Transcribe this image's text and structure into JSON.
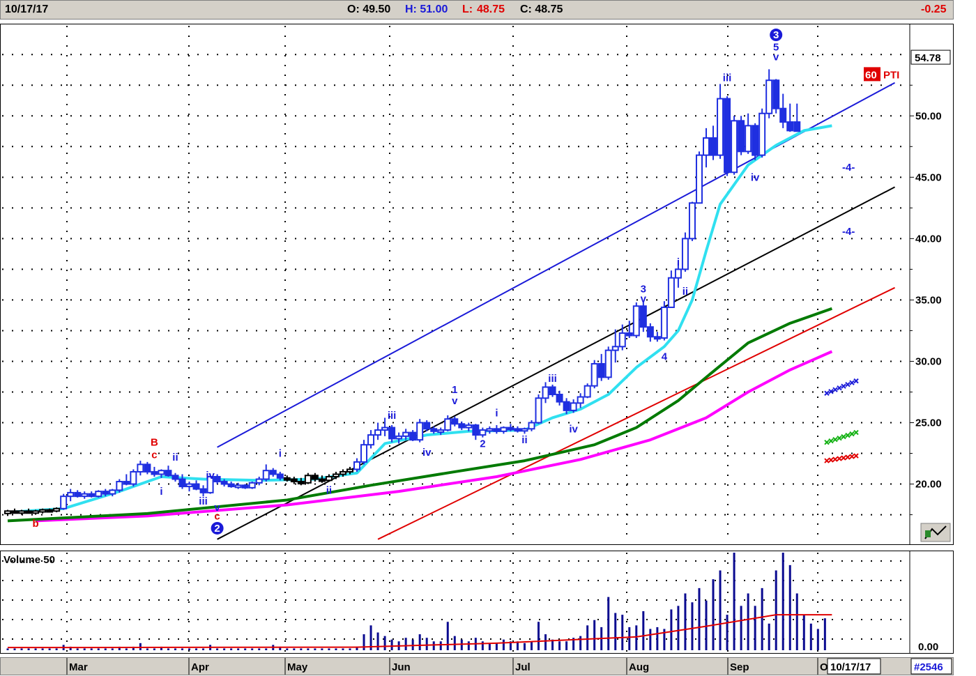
{
  "header": {
    "date": "10/17/17",
    "open": "O: 49.50",
    "high": "H: 51.00",
    "low_label": "L:",
    "low_value": "48.75",
    "close": "C: 48.75",
    "change": "-0.25"
  },
  "colors": {
    "candles": "#1f2fe0",
    "candles_early": "#000000",
    "ema_short": "#30e0f0",
    "ma_mid": "#007a00",
    "ma_long": "#ff00ff",
    "channel_upper": "#1a1ad8",
    "channel_mid": "#000000",
    "channel_lower": "#e00000",
    "volume_bars": "#0a0a90",
    "volume_avg": "#e00000"
  },
  "icons": [
    "chart-settings-icon"
  ],
  "chart_data": {
    "type": "candlestick",
    "ylim": [
      16,
      57
    ],
    "y_ticks": [
      "20.00",
      "25.00",
      "30.00",
      "35.00",
      "40.00",
      "45.00",
      "50.00"
    ],
    "last_price_label": "54.78",
    "indicator_label": {
      "number": "60",
      "text": "PTI"
    },
    "months": [
      "Mar",
      "Apr",
      "May",
      "Jun",
      "Jul",
      "Aug",
      "Sep",
      "O"
    ],
    "current_date_label": "10/17/17",
    "volume_title": "Volume 50",
    "volume_tick": "0.00",
    "footer_code": "#2546",
    "candles": [
      [
        17.6,
        17.9,
        17.4,
        17.8
      ],
      [
        17.8,
        18.0,
        17.6,
        17.7
      ],
      [
        17.7,
        17.9,
        17.5,
        17.8
      ],
      [
        17.8,
        18.0,
        17.6,
        17.7
      ],
      [
        17.7,
        17.9,
        17.5,
        17.8
      ],
      [
        17.8,
        18.0,
        17.6,
        17.9
      ],
      [
        17.9,
        18.0,
        17.7,
        17.8
      ],
      [
        17.8,
        18.1,
        17.7,
        18.0
      ],
      [
        18.0,
        19.2,
        17.9,
        19.0
      ],
      [
        19.0,
        19.6,
        18.6,
        19.3
      ],
      [
        19.3,
        19.5,
        18.9,
        19.0
      ],
      [
        19.0,
        19.4,
        18.8,
        19.2
      ],
      [
        19.2,
        19.4,
        18.9,
        19.0
      ],
      [
        19.0,
        19.5,
        18.9,
        19.4
      ],
      [
        19.4,
        19.6,
        19.0,
        19.2
      ],
      [
        19.2,
        19.6,
        19.0,
        19.5
      ],
      [
        19.5,
        20.4,
        19.3,
        20.2
      ],
      [
        20.2,
        20.8,
        19.9,
        20.0
      ],
      [
        20.0,
        21.2,
        19.8,
        21.0
      ],
      [
        21.0,
        21.9,
        20.7,
        21.6
      ],
      [
        21.6,
        21.8,
        20.8,
        21.0
      ],
      [
        21.0,
        21.4,
        20.6,
        20.8
      ],
      [
        20.8,
        21.2,
        20.5,
        21.1
      ],
      [
        21.1,
        21.5,
        20.6,
        20.7
      ],
      [
        20.7,
        20.9,
        20.2,
        20.4
      ],
      [
        20.4,
        20.8,
        19.6,
        19.8
      ],
      [
        19.8,
        20.2,
        19.4,
        20.0
      ],
      [
        20.0,
        20.3,
        19.5,
        19.6
      ],
      [
        19.6,
        19.9,
        19.0,
        19.3
      ],
      [
        19.3,
        20.8,
        19.2,
        20.6
      ],
      [
        20.6,
        20.8,
        20.0,
        20.2
      ],
      [
        20.2,
        20.4,
        19.8,
        20.0
      ],
      [
        20.0,
        20.2,
        19.7,
        19.8
      ],
      [
        19.8,
        20.1,
        19.6,
        19.9
      ],
      [
        19.9,
        20.0,
        19.6,
        19.7
      ],
      [
        19.7,
        20.2,
        19.6,
        20.1
      ],
      [
        20.1,
        20.6,
        19.9,
        20.4
      ],
      [
        20.4,
        21.6,
        20.2,
        21.1
      ],
      [
        21.1,
        21.3,
        20.6,
        20.8
      ],
      [
        20.8,
        21.0,
        20.3,
        20.5
      ],
      [
        20.5,
        20.7,
        20.2,
        20.4
      ],
      [
        20.4,
        20.6,
        20.0,
        20.2
      ],
      [
        20.2,
        20.5,
        19.9,
        20.1
      ],
      [
        20.1,
        20.9,
        20.0,
        20.7
      ],
      [
        20.7,
        20.9,
        20.2,
        20.4
      ],
      [
        20.4,
        20.7,
        20.1,
        20.3
      ],
      [
        20.3,
        20.8,
        20.2,
        20.6
      ],
      [
        20.6,
        21.0,
        20.4,
        20.8
      ],
      [
        20.8,
        21.2,
        20.6,
        21.0
      ],
      [
        21.0,
        21.4,
        20.8,
        21.2
      ],
      [
        21.2,
        22.1,
        21.0,
        21.8
      ],
      [
        21.8,
        23.6,
        21.6,
        23.2
      ],
      [
        23.2,
        24.4,
        22.9,
        24.0
      ],
      [
        24.0,
        25.0,
        23.6,
        24.4
      ],
      [
        24.4,
        25.4,
        23.9,
        24.6
      ],
      [
        24.6,
        24.8,
        23.4,
        23.7
      ],
      [
        23.7,
        24.2,
        23.3,
        23.9
      ],
      [
        23.9,
        24.5,
        23.6,
        24.2
      ],
      [
        24.2,
        24.4,
        23.5,
        23.6
      ],
      [
        23.6,
        25.3,
        23.4,
        25.0
      ],
      [
        25.0,
        25.2,
        24.3,
        24.5
      ],
      [
        24.5,
        24.7,
        24.1,
        24.3
      ],
      [
        24.3,
        24.6,
        24.0,
        24.4
      ],
      [
        24.4,
        25.6,
        24.3,
        25.3
      ],
      [
        25.3,
        25.5,
        24.7,
        24.9
      ],
      [
        24.9,
        25.1,
        24.4,
        24.6
      ],
      [
        24.6,
        25.0,
        24.3,
        24.8
      ],
      [
        24.8,
        24.9,
        23.6,
        24.0
      ],
      [
        24.0,
        24.6,
        23.8,
        24.4
      ],
      [
        24.4,
        24.7,
        24.1,
        24.5
      ],
      [
        24.5,
        24.8,
        24.1,
        24.3
      ],
      [
        24.3,
        24.7,
        24.1,
        24.6
      ],
      [
        24.6,
        24.9,
        24.3,
        24.5
      ],
      [
        24.5,
        24.7,
        24.2,
        24.4
      ],
      [
        24.4,
        24.6,
        24.1,
        24.5
      ],
      [
        24.5,
        25.2,
        24.3,
        25.0
      ],
      [
        25.0,
        27.3,
        24.9,
        27.0
      ],
      [
        27.0,
        28.3,
        26.6,
        27.9
      ],
      [
        27.9,
        28.1,
        27.1,
        27.3
      ],
      [
        27.3,
        27.6,
        26.4,
        26.7
      ],
      [
        26.7,
        27.0,
        25.7,
        26.0
      ],
      [
        26.0,
        26.9,
        25.8,
        26.6
      ],
      [
        26.6,
        27.4,
        26.2,
        27.1
      ],
      [
        27.1,
        28.2,
        27.0,
        28.0
      ],
      [
        28.0,
        30.1,
        27.8,
        29.8
      ],
      [
        29.8,
        30.6,
        28.4,
        28.7
      ],
      [
        28.7,
        31.2,
        28.5,
        30.9
      ],
      [
        30.9,
        32.6,
        29.9,
        31.2
      ],
      [
        31.2,
        33.0,
        30.9,
        32.3
      ],
      [
        32.3,
        33.3,
        31.9,
        32.1
      ],
      [
        32.1,
        34.8,
        31.9,
        34.5
      ],
      [
        34.5,
        34.9,
        32.4,
        32.8
      ],
      [
        32.8,
        33.1,
        31.6,
        32.0
      ],
      [
        32.0,
        32.4,
        31.6,
        31.9
      ],
      [
        31.9,
        34.9,
        31.7,
        34.4
      ],
      [
        34.4,
        37.4,
        36.1,
        36.8
      ],
      [
        36.8,
        38.0,
        36.0,
        37.5
      ],
      [
        37.5,
        40.5,
        37.3,
        40.0
      ],
      [
        40.0,
        43.0,
        39.8,
        42.9
      ],
      [
        42.9,
        47.1,
        43.4,
        46.8
      ],
      [
        46.8,
        49.0,
        45.8,
        48.2
      ],
      [
        48.2,
        49.2,
        46.4,
        46.8
      ],
      [
        46.8,
        52.6,
        46.5,
        51.4
      ],
      [
        51.4,
        51.6,
        45.1,
        45.4
      ],
      [
        45.4,
        50.0,
        45.2,
        49.6
      ],
      [
        49.6,
        50.0,
        46.8,
        47.1
      ],
      [
        47.1,
        50.2,
        46.9,
        49.2
      ],
      [
        49.2,
        49.4,
        46.4,
        46.8
      ],
      [
        46.8,
        50.6,
        46.6,
        50.2
      ],
      [
        50.2,
        53.8,
        49.8,
        52.9
      ],
      [
        52.9,
        53.0,
        50.2,
        50.6
      ],
      [
        50.6,
        51.8,
        49.0,
        49.5
      ],
      [
        49.5,
        51.0,
        48.7,
        48.8
      ],
      [
        49.5,
        51.0,
        48.75,
        48.75
      ]
    ],
    "ema_short": [
      [
        0,
        17.7
      ],
      [
        8,
        18.0
      ],
      [
        16,
        19.4
      ],
      [
        22,
        20.6
      ],
      [
        28,
        20.4
      ],
      [
        36,
        20.3
      ],
      [
        44,
        20.4
      ],
      [
        50,
        20.9
      ],
      [
        54,
        23.3
      ],
      [
        60,
        24.0
      ],
      [
        66,
        24.3
      ],
      [
        74,
        24.4
      ],
      [
        78,
        25.4
      ],
      [
        82,
        26.1
      ],
      [
        86,
        27.3
      ],
      [
        90,
        29.5
      ],
      [
        94,
        31.2
      ],
      [
        96,
        32.5
      ],
      [
        98,
        35.0
      ],
      [
        100,
        39.0
      ],
      [
        102,
        42.8
      ],
      [
        106,
        46.0
      ],
      [
        110,
        47.6
      ],
      [
        114,
        48.8
      ],
      [
        118,
        49.2
      ]
    ],
    "ma_mid": [
      [
        0,
        17.0
      ],
      [
        20,
        17.6
      ],
      [
        40,
        18.7
      ],
      [
        52,
        19.9
      ],
      [
        64,
        21.0
      ],
      [
        74,
        21.9
      ],
      [
        84,
        23.2
      ],
      [
        90,
        24.6
      ],
      [
        96,
        26.8
      ],
      [
        100,
        28.7
      ],
      [
        106,
        31.5
      ],
      [
        112,
        33.1
      ],
      [
        118,
        34.3
      ]
    ],
    "ma_long": [
      [
        4,
        17.0
      ],
      [
        20,
        17.4
      ],
      [
        40,
        18.3
      ],
      [
        56,
        19.4
      ],
      [
        70,
        20.6
      ],
      [
        82,
        22.0
      ],
      [
        92,
        23.6
      ],
      [
        100,
        25.4
      ],
      [
        106,
        27.5
      ],
      [
        112,
        29.3
      ],
      [
        118,
        30.8
      ]
    ],
    "channel_upper": [
      [
        30,
        23.0
      ],
      [
        127,
        52.7
      ]
    ],
    "channel_mid": [
      [
        30,
        15.5
      ],
      [
        127,
        44.2
      ]
    ],
    "channel_lower": [
      [
        53,
        15.5
      ],
      [
        127,
        36.0
      ]
    ],
    "crossed_points": [
      {
        "series": "upper_band",
        "color": "#1a1ad8",
        "from": 27.4,
        "to": 28.4
      },
      {
        "series": "mid_band",
        "color": "#10b010",
        "from": 23.4,
        "to": 24.2
      },
      {
        "series": "lower_band",
        "color": "#e00000",
        "from": 21.9,
        "to": 22.3
      }
    ],
    "target_labels": [
      {
        "text": "-4-",
        "value": 45.8
      },
      {
        "text": "-4-",
        "value": 40.6
      }
    ],
    "wave_labels": [
      {
        "text": "b",
        "x": 4,
        "value": 16.8,
        "color": "#e00000"
      },
      {
        "text": "B",
        "x": 21,
        "value": 23.4,
        "color": "#e00000"
      },
      {
        "text": "c",
        "x": 21,
        "value": 22.4,
        "color": "#e00000"
      },
      {
        "text": "i",
        "x": 22,
        "value": 19.4,
        "color": "#1a1ad8"
      },
      {
        "text": "ii",
        "x": 24,
        "value": 22.2,
        "color": "#1a1ad8"
      },
      {
        "text": "iii",
        "x": 28,
        "value": 18.6,
        "color": "#1a1ad8"
      },
      {
        "text": "iv",
        "x": 29,
        "value": 20.7,
        "color": "#1a1ad8"
      },
      {
        "text": "v",
        "x": 30,
        "value": 18.1,
        "color": "#1a1ad8"
      },
      {
        "text": "c",
        "x": 30,
        "value": 17.4,
        "color": "#e00000"
      },
      {
        "text": "i",
        "x": 39,
        "value": 22.5,
        "color": "#1a1ad8"
      },
      {
        "text": "ii",
        "x": 46,
        "value": 19.5,
        "color": "#1a1ad8"
      },
      {
        "text": "iii",
        "x": 55,
        "value": 25.6,
        "color": "#1a1ad8"
      },
      {
        "text": "iv",
        "x": 60,
        "value": 22.6,
        "color": "#1a1ad8"
      },
      {
        "text": "1",
        "x": 64,
        "value": 27.7,
        "color": "#1a1ad8"
      },
      {
        "text": "v",
        "x": 64,
        "value": 26.8,
        "color": "#1a1ad8"
      },
      {
        "text": "2",
        "x": 68,
        "value": 23.3,
        "color": "#1a1ad8"
      },
      {
        "text": "i",
        "x": 70,
        "value": 25.8,
        "color": "#1a1ad8"
      },
      {
        "text": "ii",
        "x": 74,
        "value": 23.6,
        "color": "#1a1ad8"
      },
      {
        "text": "iii",
        "x": 78,
        "value": 28.6,
        "color": "#1a1ad8"
      },
      {
        "text": "iv",
        "x": 81,
        "value": 24.5,
        "color": "#1a1ad8"
      },
      {
        "text": "3",
        "x": 91,
        "value": 35.9,
        "color": "#1a1ad8"
      },
      {
        "text": "v",
        "x": 91,
        "value": 35.1,
        "color": "#1a1ad8"
      },
      {
        "text": "4",
        "x": 94,
        "value": 30.4,
        "color": "#1a1ad8"
      },
      {
        "text": "i",
        "x": 96,
        "value": 38.1,
        "color": "#1a1ad8"
      },
      {
        "text": "ii",
        "x": 97,
        "value": 35.7,
        "color": "#1a1ad8"
      },
      {
        "text": "iii",
        "x": 103,
        "value": 53.1,
        "color": "#1a1ad8"
      },
      {
        "text": "iv",
        "x": 107,
        "value": 45.0,
        "color": "#1a1ad8"
      },
      {
        "text": "5",
        "x": 110,
        "value": 55.6,
        "color": "#1a1ad8"
      },
      {
        "text": "v",
        "x": 110,
        "value": 54.8,
        "color": "#1a1ad8"
      }
    ],
    "circled_labels": [
      {
        "text": "2",
        "x": 30,
        "value": 16.4
      },
      {
        "text": "3",
        "x": 110,
        "value": 56.6
      }
    ],
    "volume": [
      1,
      1,
      1,
      1,
      1,
      1,
      1,
      1,
      3,
      2,
      1,
      1,
      1,
      1,
      1,
      1,
      2,
      1,
      2,
      4,
      1,
      1,
      2,
      1,
      1,
      1,
      1,
      1,
      1,
      3,
      1,
      1,
      1,
      1,
      1,
      1,
      1,
      1,
      3,
      2,
      1,
      1,
      1,
      1,
      1,
      1,
      1,
      1,
      1,
      1,
      2,
      9,
      14,
      10,
      8,
      6,
      5,
      7,
      6,
      9,
      7,
      5,
      5,
      16,
      8,
      6,
      5,
      7,
      5,
      4,
      4,
      6,
      5,
      5,
      4,
      5,
      16,
      9,
      6,
      5,
      5,
      7,
      8,
      14,
      17,
      13,
      30,
      21,
      20,
      13,
      14,
      22,
      12,
      13,
      12,
      23,
      25,
      32,
      27,
      35,
      28,
      40,
      45,
      20,
      55,
      25,
      32,
      25,
      35,
      15,
      45,
      55,
      48,
      32,
      20,
      15,
      12,
      18
    ],
    "volume_avg": [
      [
        0,
        1.5
      ],
      [
        50,
        1.7
      ],
      [
        70,
        4.0
      ],
      [
        90,
        7.5
      ],
      [
        100,
        13.5
      ],
      [
        110,
        20
      ],
      [
        118,
        20
      ]
    ]
  }
}
